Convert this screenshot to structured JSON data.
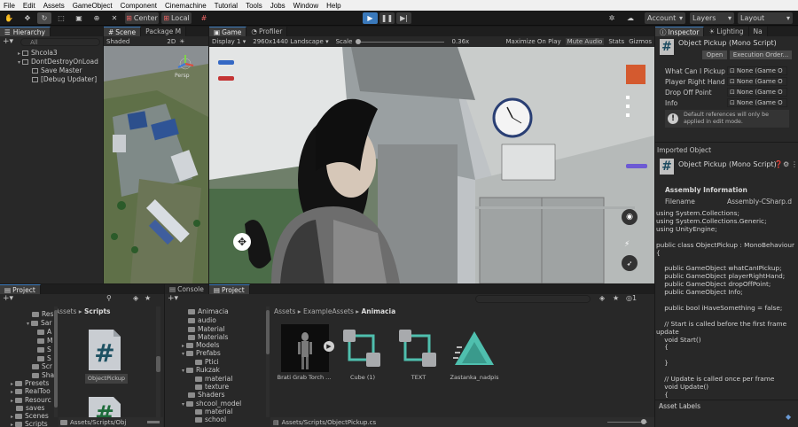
{
  "menu": [
    "File",
    "Edit",
    "Assets",
    "GameObject",
    "Component",
    "Cinemachine",
    "Tutorial",
    "Tools",
    "Jobs",
    "Window",
    "Help"
  ],
  "toolbar": {
    "center": "Center",
    "local": "Local",
    "account": "Account",
    "layers": "Layers",
    "layout": "Layout"
  },
  "hierarchy": {
    "tab": "Hierarchy",
    "search": "All",
    "items": [
      "Shcola3",
      "DontDestroyOnLoad",
      "Save Master",
      "[Debug Updater]"
    ]
  },
  "scene": {
    "tab": "Scene",
    "tab2": "Package M",
    "shading": "Shaded",
    "mode": "2D",
    "persp": "Persp"
  },
  "game": {
    "tab": "Game",
    "tab2": "Profiler",
    "display": "Display 1",
    "resolution": "2960x1440 Landscape",
    "scale_label": "Scale",
    "scale_value": "0.36x",
    "maximize": "Maximize On Play",
    "mute": "Mute Audio",
    "stats": "Stats",
    "gizmos": "Gizmos"
  },
  "inspector": {
    "tabs": [
      "Inspector",
      "Lighting",
      "Na"
    ],
    "title": "Object Pickup (Mono Script)",
    "open": "Open",
    "exec": "Execution Order...",
    "fields": [
      {
        "label": "What Can I Pickup",
        "value": "None (Game O"
      },
      {
        "label": "Player Right Hand",
        "value": "None (Game O"
      },
      {
        "label": "Drop Off Point",
        "value": "None (Game O"
      },
      {
        "label": "Info",
        "value": "None (Game O"
      }
    ],
    "note": "Default references will only be applied in edit mode.",
    "imported": "Imported Object",
    "imported_title": "Object Pickup (Mono Script)",
    "assembly_header": "Assembly Information",
    "filename_label": "Filename",
    "filename_value": "Assembly-CSharp.d",
    "code": "using System.Collections;\nusing System.Collections.Generic;\nusing UnityEngine;\n\npublic class ObjectPickup : MonoBehaviour\n{\n\n    public GameObject whatCanIPickup;\n    public GameObject playerRightHand;\n    public GameObject dropOffPoint;\n    public GameObject Info;\n\n    public bool iHaveSomething = false;\n\n    // Start is called before the first frame\nupdate\n    void Start()\n    {\n\n    }\n\n    // Update is called once per frame\n    void Update()\n    {",
    "asset_labels": "Asset Labels"
  },
  "project_left": {
    "tab": "Project",
    "breadcrumb": [
      "Assets",
      "Scripts"
    ],
    "tree": [
      "Res",
      "Sar",
      "A",
      "M",
      "S",
      "S",
      "Scr",
      "Sha",
      "Presets",
      "RealToo",
      "Resourc",
      "saves",
      "Scenes",
      "Scripts"
    ],
    "file_name": "ObjectPickup",
    "path": "Assets/Scripts/Obj"
  },
  "project_right": {
    "tabs": [
      "Console",
      "Project"
    ],
    "tree": [
      "Animacia",
      "audio",
      "Material",
      "Materials",
      "Models",
      "Prefabs",
      "Ptici",
      "Rukzak",
      "material",
      "texture",
      "Shaders",
      "shcool_model",
      "material",
      "school"
    ],
    "breadcrumb": [
      "Assets",
      "ExampleAssets",
      "Animacia"
    ],
    "items": [
      "Brati Grab Torch ...",
      "Cube (1)",
      "TEXT",
      "Zastanka_nadpis"
    ],
    "path": "Assets/Scripts/ObjectPickup.cs",
    "count": "1"
  },
  "colors": {
    "accent": "#3a79bb",
    "teal": "#4fbfae",
    "bg": "#282828",
    "menubar": "#f0f0f0"
  }
}
